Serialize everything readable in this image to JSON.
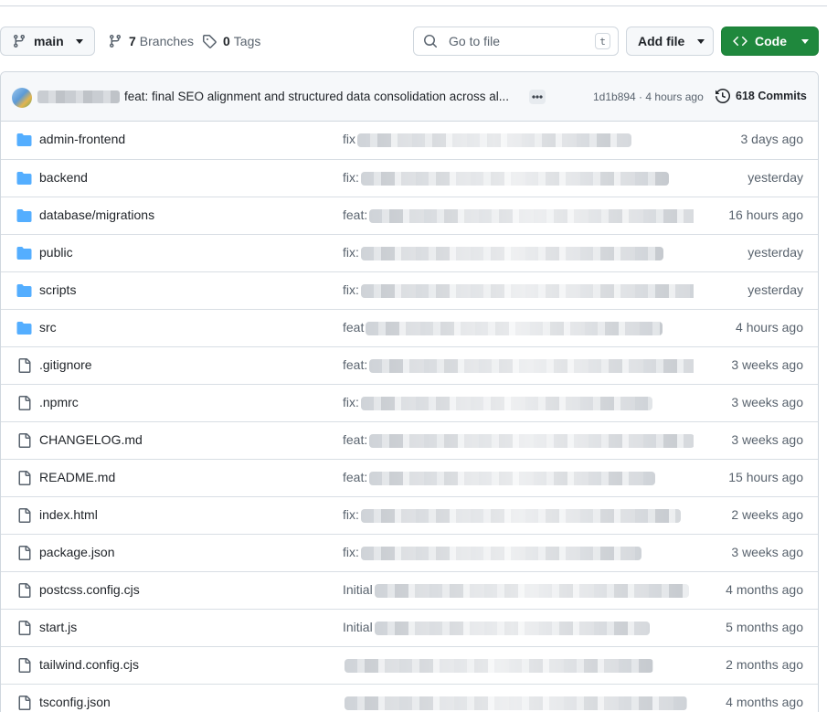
{
  "toolbar": {
    "branch_name": "main",
    "branches_count": "7",
    "branches_label": "Branches",
    "tags_count": "0",
    "tags_label": "Tags",
    "search_placeholder": "Go to file",
    "search_shortcut": "t",
    "add_file_label": "Add file",
    "code_label": "Code",
    "code_accent": "#1f883d"
  },
  "commit": {
    "message": "feat: final SEO alignment and structured data consolidation across al...",
    "sha": "1d1b894",
    "separator": " · ",
    "age": "4 hours ago",
    "history_label": "618 Commits"
  },
  "files": [
    {
      "name": "admin-frontend",
      "type": "folder",
      "msg_prefix": "fix",
      "age": "3 days ago"
    },
    {
      "name": "backend",
      "type": "folder",
      "msg_prefix": "fix:",
      "age": "yesterday"
    },
    {
      "name": "database/migrations",
      "type": "folder",
      "msg_prefix": "feat:",
      "age": "16 hours ago"
    },
    {
      "name": "public",
      "type": "folder",
      "msg_prefix": "fix:",
      "age": "yesterday"
    },
    {
      "name": "scripts",
      "type": "folder",
      "msg_prefix": "fix:",
      "age": "yesterday"
    },
    {
      "name": "src",
      "type": "folder",
      "msg_prefix": "feat",
      "age": "4 hours ago"
    },
    {
      "name": ".gitignore",
      "type": "file",
      "msg_prefix": "feat:",
      "age": "3 weeks ago"
    },
    {
      "name": ".npmrc",
      "type": "file",
      "msg_prefix": "fix:",
      "age": "3 weeks ago"
    },
    {
      "name": "CHANGELOG.md",
      "type": "file",
      "msg_prefix": "feat:",
      "age": "3 weeks ago"
    },
    {
      "name": "README.md",
      "type": "file",
      "msg_prefix": "feat:",
      "age": "15 hours ago"
    },
    {
      "name": "index.html",
      "type": "file",
      "msg_prefix": "fix:",
      "age": "2 weeks ago"
    },
    {
      "name": "package.json",
      "type": "file",
      "msg_prefix": "fix:",
      "age": "3 weeks ago"
    },
    {
      "name": "postcss.config.cjs",
      "type": "file",
      "msg_prefix": "Initial",
      "age": "4 months ago"
    },
    {
      "name": "start.js",
      "type": "file",
      "msg_prefix": "Initial",
      "age": "5 months ago"
    },
    {
      "name": "tailwind.config.cjs",
      "type": "file",
      "msg_prefix": "",
      "age": "2 months ago"
    },
    {
      "name": "tsconfig.json",
      "type": "file",
      "msg_prefix": "",
      "age": "4 months ago"
    }
  ],
  "icons": {
    "folder": "folder-icon",
    "file": "file-icon",
    "folder_color": "#54aeff"
  }
}
